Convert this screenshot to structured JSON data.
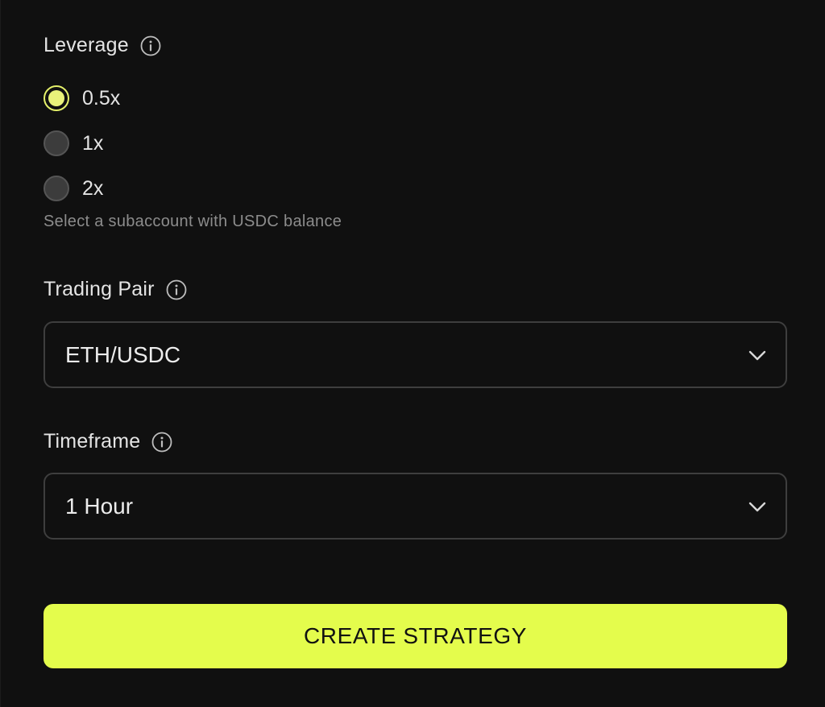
{
  "leverage": {
    "label": "Leverage",
    "options": [
      {
        "label": "0.5x",
        "selected": true
      },
      {
        "label": "1x",
        "selected": false
      },
      {
        "label": "2x",
        "selected": false
      }
    ],
    "helper_text": "Select a subaccount with USDC balance"
  },
  "trading_pair": {
    "label": "Trading Pair",
    "value": "ETH/USDC"
  },
  "timeframe": {
    "label": "Timeframe",
    "value": "1 Hour"
  },
  "create_button": {
    "label": "CREATE STRATEGY"
  },
  "colors": {
    "accent": "#e4fc4c",
    "background": "#101010",
    "border": "#3e3e3e",
    "helper_text": "#8c8c8c"
  },
  "icons": {
    "info": "info-icon",
    "dropdown": "chevron-down-icon"
  }
}
